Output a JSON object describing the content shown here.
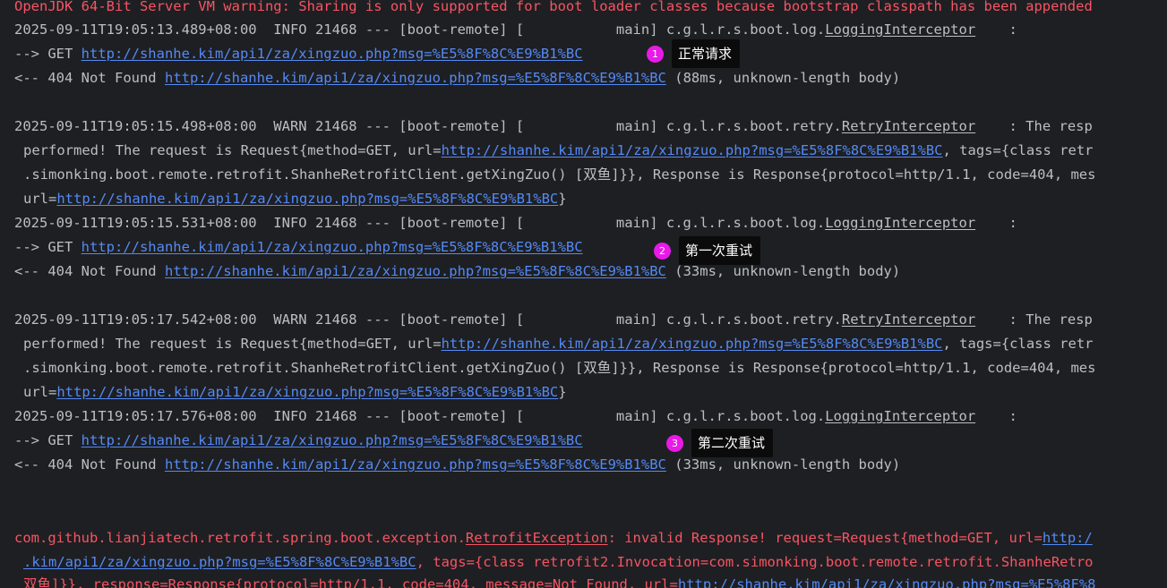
{
  "console": {
    "warning": "OpenJDK 64-Bit Server VM warning: Sharing is only supported for boot loader classes because bootstrap classpath has been appended",
    "url": "http://shanhe.kim/api1/za/xingzuo.php?msg=%E5%8F%8C%E9%B1%BC",
    "blocks": [
      {
        "info_header": "2025-09-11T19:05:13.489+08:00  INFO 21468 --- [boot-remote] [           main] c.g.l.r.s.boot.log.",
        "info_class": "LoggingInterceptor",
        "info_tail": "    :",
        "get_prefix": "--> GET ",
        "resp_prefix": "<-- 404 Not Found ",
        "resp_suffix": " (88ms, unknown-length body)"
      },
      {
        "warn_header": "2025-09-11T19:05:15.498+08:00  WARN 21468 --- [boot-remote] [           main] c.g.l.r.s.boot.retry.",
        "warn_class": "RetryInterceptor",
        "warn_tail": "    : The resp",
        "warn_l2_prefix": "performed! The request is Request{method=GET, url=",
        "warn_l2_suffix": ", tags={class retr",
        "warn_l3": ".simonking.boot.remote.retrofit.ShanheRetrofitClient.getXingZuo() [双鱼]}}, Response is Response{protocol=http/1.1, code=404, mes",
        "warn_l4_prefix": "url=",
        "warn_l4_suffix": "}",
        "info_header": "2025-09-11T19:05:15.531+08:00  INFO 21468 --- [boot-remote] [           main] c.g.l.r.s.boot.log.",
        "info_class": "LoggingInterceptor",
        "info_tail": "    :",
        "get_prefix": "--> GET ",
        "resp_prefix": "<-- 404 Not Found ",
        "resp_suffix": " (33ms, unknown-length body)"
      },
      {
        "warn_header": "2025-09-11T19:05:17.542+08:00  WARN 21468 --- [boot-remote] [           main] c.g.l.r.s.boot.retry.",
        "warn_class": "RetryInterceptor",
        "warn_tail": "    : The resp",
        "warn_l2_prefix": "performed! The request is Request{method=GET, url=",
        "warn_l2_suffix": ", tags={class retr",
        "warn_l3": ".simonking.boot.remote.retrofit.ShanheRetrofitClient.getXingZuo() [双鱼]}}, Response is Response{protocol=http/1.1, code=404, mes",
        "warn_l4_prefix": "url=",
        "warn_l4_suffix": "}",
        "info_header": "2025-09-11T19:05:17.576+08:00  INFO 21468 --- [boot-remote] [           main] c.g.l.r.s.boot.log.",
        "info_class": "LoggingInterceptor",
        "info_tail": "    :",
        "get_prefix": "--> GET ",
        "resp_prefix": "<-- 404 Not Found ",
        "resp_suffix": " (33ms, unknown-length body)"
      }
    ],
    "exception": {
      "l1_prefix": "com.github.lianjiatech.retrofit.spring.boot.exception.",
      "l1_class": "RetrofitException",
      "l1_text": ": invalid Response! request=Request{method=GET, url=",
      "l1_link": "http:/",
      "l2_link": ".kim/api1/za/xingzuo.php?msg=%E5%8F%8C%E9%B1%BC",
      "l2_text": ", tags={class retrofit2.Invocation=com.simonking.boot.remote.retrofit.ShanheRetro",
      "l3_text": "双鱼]}}, response=Response{protocol=http/1.1, code=404, message=Not Found, url=",
      "l3_link": "http://shanhe.kim/api1/za/xingzuo.php?msg=%E5%8F%8"
    }
  },
  "annotations": [
    {
      "number": "1",
      "label": "正常请求"
    },
    {
      "number": "2",
      "label": "第一次重试"
    },
    {
      "number": "3",
      "label": "第二次重试"
    }
  ],
  "colors": {
    "background": "#1e1f22",
    "text": "#bcbec4",
    "link": "#548af7",
    "error": "#f75464",
    "badge": "#e81ae8",
    "callout_bg": "#0b0b0c"
  }
}
